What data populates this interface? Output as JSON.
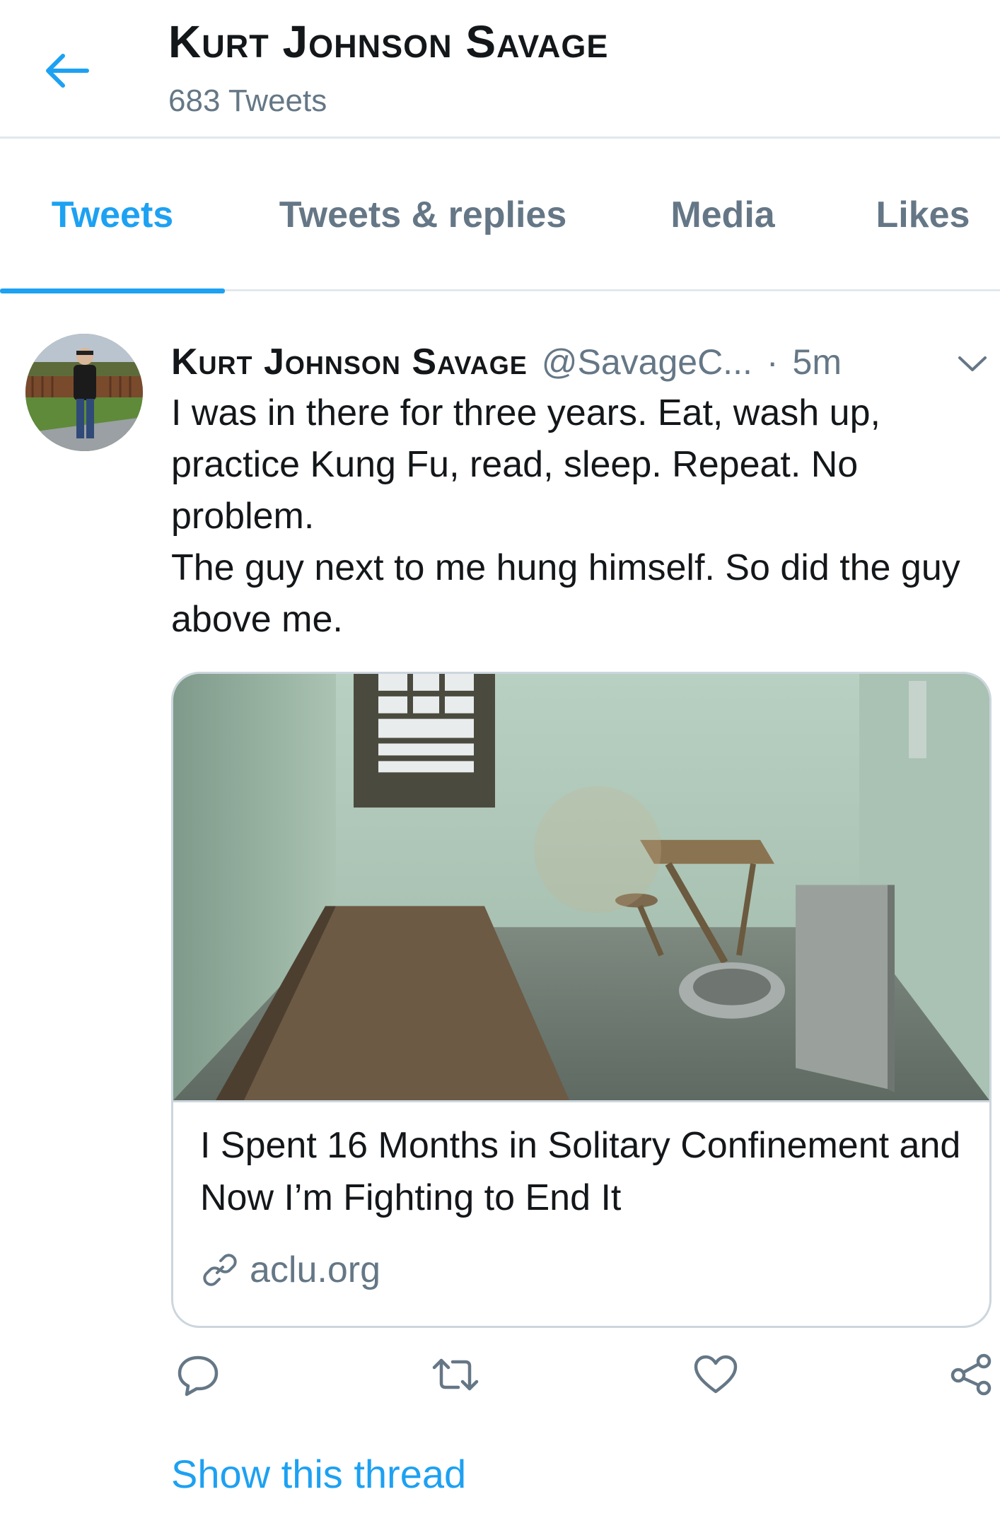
{
  "header": {
    "back_icon": "arrow-left-icon",
    "title": "Kurt Johnson Savage",
    "subtitle": "683 Tweets"
  },
  "tabs": [
    {
      "label": "Tweets",
      "active": true
    },
    {
      "label": "Tweets & replies",
      "active": false
    },
    {
      "label": "Media",
      "active": false
    },
    {
      "label": "Likes",
      "active": false
    }
  ],
  "tweet": {
    "author_name": "Kurt Johnson Savage",
    "author_handle": "@SavageC...",
    "separator": "·",
    "time": "5m",
    "text_lines": [
      "I was in there for three years. Eat, wash up, practice Kung Fu, read, sleep. Repeat. No problem.",
      "The guy next to me hung himself. So did the guy above me."
    ],
    "card": {
      "title": "I Spent 16 Months in Solitary Confinement and Now I’m Fighting to End It",
      "domain": "aclu.org"
    },
    "actions": [
      "reply-icon",
      "retweet-icon",
      "like-icon",
      "share-icon"
    ],
    "show_thread": "Show this thread"
  },
  "colors": {
    "accent": "#1da1f2",
    "secondary_text": "#657786",
    "border": "#e1e8ed"
  }
}
